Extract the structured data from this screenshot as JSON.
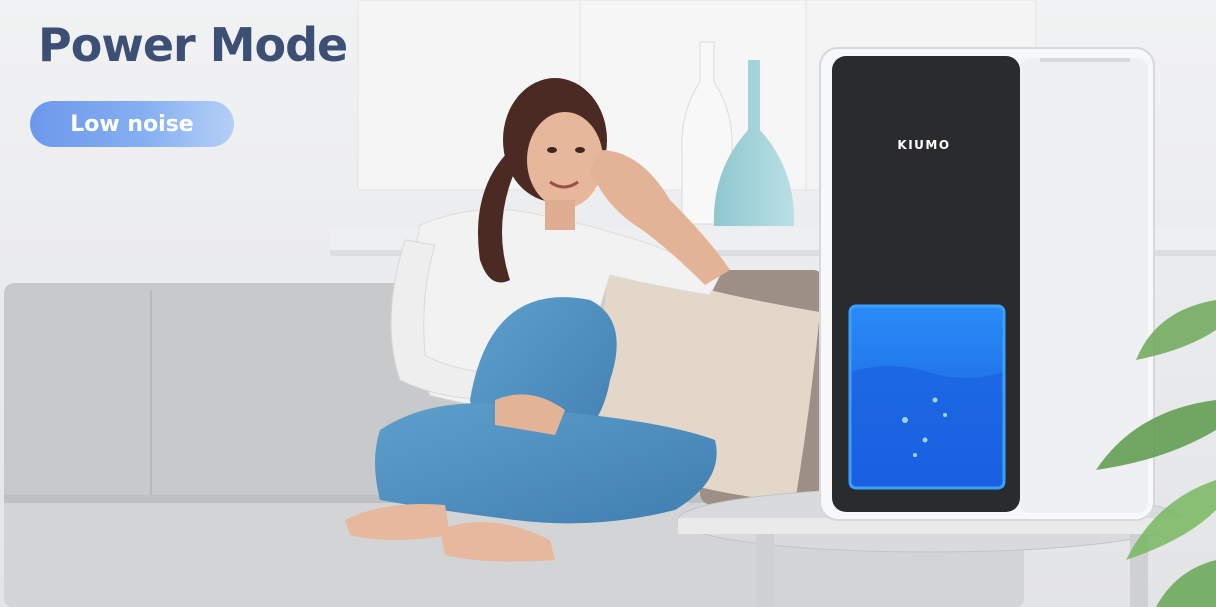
{
  "banner": {
    "title": "Power Mode",
    "badge_label": "Low noise"
  },
  "product": {
    "brand": "KIUMO"
  },
  "colors": {
    "title": "#3d4f74",
    "badge_start": "#6c98ec",
    "badge_end": "#b4cff6",
    "water_tank": "#1f7cf0",
    "device_body": "#f7f8f9",
    "device_panel": "#2a2b2d"
  },
  "scene": {
    "description_elements": [
      "sofa",
      "woman",
      "cushion",
      "vases",
      "side-table",
      "dehumidifier",
      "plant"
    ]
  }
}
